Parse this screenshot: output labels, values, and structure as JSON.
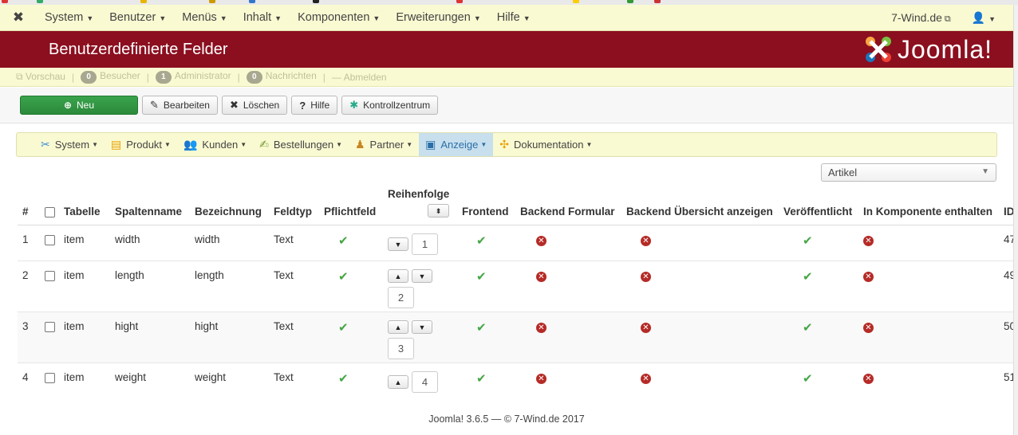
{
  "navbar": {
    "menu": [
      {
        "label": "System"
      },
      {
        "label": "Benutzer"
      },
      {
        "label": "Menüs"
      },
      {
        "label": "Inhalt"
      },
      {
        "label": "Komponenten"
      },
      {
        "label": "Erweiterungen"
      },
      {
        "label": "Hilfe"
      }
    ],
    "site_link": "7-Wind.de",
    "brand_icon": "joomla-icon",
    "user_icon": "user-icon"
  },
  "header": {
    "title": "Benutzerdefinierte Felder",
    "logo_text": "Joomla!"
  },
  "statusbar": {
    "preview": "Vorschau",
    "visitors_count": "0",
    "visitors": "Besucher",
    "admins_count": "1",
    "admins": "Administrator",
    "messages_count": "0",
    "messages": "Nachrichten",
    "logout": "Abmelden"
  },
  "toolbar": {
    "new": "Neu",
    "edit": "Bearbeiten",
    "delete": "Löschen",
    "help": "Hilfe",
    "control_center": "Kontrollzentrum"
  },
  "submenu": [
    {
      "label": "System",
      "icon": "tools-icon"
    },
    {
      "label": "Produkt",
      "icon": "box-icon"
    },
    {
      "label": "Kunden",
      "icon": "users-icon"
    },
    {
      "label": "Bestellungen",
      "icon": "orders-icon"
    },
    {
      "label": "Partner",
      "icon": "partner-icon"
    },
    {
      "label": "Anzeige",
      "icon": "display-icon",
      "active": true
    },
    {
      "label": "Dokumentation",
      "icon": "docs-icon"
    }
  ],
  "filter": {
    "selected": "Artikel"
  },
  "table": {
    "headers": {
      "num": "#",
      "table": "Tabelle",
      "column": "Spaltenname",
      "label": "Bezeichnung",
      "type": "Feldtyp",
      "required": "Pflichtfeld",
      "order": "Reihenfolge",
      "frontend": "Frontend",
      "backend_form": "Backend Formular",
      "backend_list": "Backend Übersicht anzeigen",
      "published": "Veröffentlicht",
      "in_component": "In Komponente enthalten",
      "id": "ID"
    },
    "rows": [
      {
        "num": "1",
        "table": "item",
        "column": "width",
        "label": "width",
        "type": "Text",
        "order": "1",
        "id": "47"
      },
      {
        "num": "2",
        "table": "item",
        "column": "length",
        "label": "length",
        "type": "Text",
        "order": "2",
        "id": "49"
      },
      {
        "num": "3",
        "table": "item",
        "column": "hight",
        "label": "hight",
        "type": "Text",
        "order": "3",
        "id": "50"
      },
      {
        "num": "4",
        "table": "item",
        "column": "weight",
        "label": "weight",
        "type": "Text",
        "order": "4",
        "id": "51"
      }
    ]
  },
  "footer": "Joomla! 3.6.5  —  © 7-Wind.de 2017",
  "colors": {
    "header_bg": "#8b0f1f",
    "bar_bg": "#fafad2",
    "yes": "#46a546",
    "no": "#b52b27",
    "new_btn": "#2f8f3f"
  }
}
